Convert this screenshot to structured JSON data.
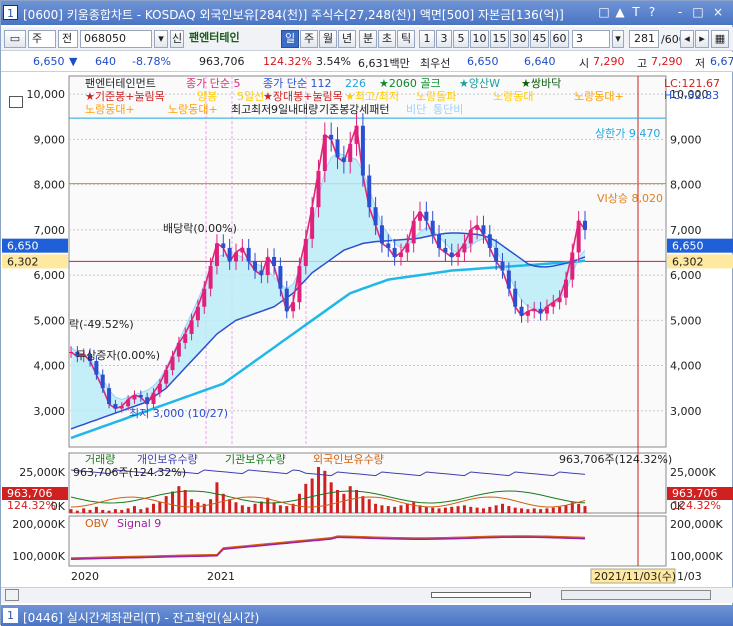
{
  "window": {
    "number": "1",
    "title": "[0600] 키움종합차트 - KOSDAQ 외국인보유[284(천)] 주식수[27,248(천)] 액면[500] 자본금[136(억)]",
    "title_buttons": [
      "□",
      "▲",
      "T",
      "?",
      "-",
      "□",
      "×"
    ]
  },
  "toolbar": {
    "market": "주",
    "code_label": "전",
    "code": "068050",
    "new_badge": "신",
    "stock_name": "팬엔터테인",
    "periods": [
      "일",
      "주",
      "월",
      "년",
      "분",
      "초",
      "틱"
    ],
    "period_selected": "일",
    "intervals": [
      "1",
      "3",
      "5",
      "10",
      "15",
      "30",
      "45",
      "60"
    ],
    "interval_value": "3",
    "count": "281",
    "count_total": "/600"
  },
  "quote": {
    "price": "6,650",
    "arrow": "▼",
    "change": "640",
    "change_pct": "-8.78%",
    "volume": "963,706",
    "volume_pct": "124.32%",
    "turnover_pct": "3.54%",
    "amount": "6,631백만",
    "best_label": "최우선",
    "ask": "6,650",
    "bid": "6,640",
    "open_label": "시",
    "open": "7,290",
    "high_label": "고",
    "high": "7,290",
    "low_label": "저",
    "low": "6,67"
  },
  "chart_data": {
    "type": "line",
    "price_panel": {
      "ylim": [
        2200,
        10400
      ],
      "y_ticks": [
        "10,000",
        "9,000",
        "8,000",
        "7,000",
        "6,000",
        "5,000",
        "4,000",
        "3,000"
      ],
      "last_close": "6,650",
      "crosshair_value": "6,302",
      "upper_limit_label": "상한가 9,470",
      "vi_label": "VI상승 8,020",
      "lc_label": "LC:121.67",
      "hc_label": "HC:-32.83",
      "legend": [
        "팬엔터테인먼트",
        "종가 단순 5",
        "종가 단순 112",
        "226",
        "★2060 골크",
        "★양산W",
        "★쌍바닥",
        "★기준봉+눌림목",
        "양봉",
        "5일선",
        "★장대봉+눌림목",
        "★최고/최저",
        "노랑돌파",
        "노랑동대",
        "노랑동대+",
        "노랑동대+",
        "노랑동대+",
        "최고",
        "최저",
        "9일내",
        "대량",
        "기준봉",
        "강세패턴",
        "비단",
        "통단비"
      ],
      "annotations": [
        "배당락(0.00%)",
        "락(-49.52%)",
        "무상증자(0.00%)",
        "최저 3,000 (10/27)"
      ],
      "close": [
        4300,
        4200,
        4250,
        4100,
        3800,
        3500,
        3150,
        3050,
        3100,
        3250,
        3350,
        3300,
        3150,
        3400,
        3600,
        3900,
        4200,
        4500,
        4700,
        5000,
        5300,
        5700,
        6200,
        6700,
        6600,
        6300,
        6500,
        6600,
        6300,
        6100,
        6000,
        6400,
        6200,
        5700,
        5200,
        5400,
        6200,
        6800,
        7500,
        8300,
        9100,
        9000,
        8600,
        8500,
        8900,
        9300,
        8200,
        7500,
        7100,
        6700,
        6600,
        6400,
        6500,
        6700,
        7200,
        7400,
        7200,
        6900,
        6600,
        6500,
        6400,
        6500,
        6700,
        7000,
        7100,
        6900,
        6600,
        6300,
        6100,
        5700,
        5300,
        5100,
        5200,
        5250,
        5150,
        5300,
        5400,
        5500,
        5900,
        6500,
        7200,
        7000
      ],
      "ma_short": [
        4400,
        4300,
        4250,
        4150,
        3950,
        3700,
        3450,
        3300,
        3250,
        3300,
        3350,
        3400,
        3450,
        3550,
        3700,
        3950,
        4250,
        4550,
        4850,
        5150,
        5450,
        5800,
        6150,
        6400,
        6450,
        6450,
        6450,
        6400,
        6300,
        6250,
        6200,
        6100,
        5950,
        5800,
        5700,
        5800,
        6100,
        6550,
        7100,
        7700,
        8300,
        8600,
        8700,
        8650,
        8600,
        8550,
        8300,
        7900,
        7500,
        7100,
        6900,
        6700,
        6600,
        6650,
        6800,
        6950,
        7050,
        7000,
        6850,
        6700,
        6550,
        6500,
        6550,
        6650,
        6750,
        6800,
        6750,
        6550,
        6300,
        6000,
        5700,
        5450,
        5300,
        5250,
        5250,
        5300,
        5350,
        5450,
        5650,
        6000,
        6400,
        6550
      ],
      "ma_mid": [
        2600,
        2650,
        2700,
        2750,
        2800,
        2850,
        2900,
        2950,
        3000,
        3050,
        3100,
        3150,
        3200,
        3300,
        3400,
        3500,
        3650,
        3800,
        3950,
        4100,
        4250,
        4400,
        4550,
        4700,
        4800,
        4900,
        5000,
        5050,
        5100,
        5150,
        5200,
        5250,
        5300,
        5400,
        5500,
        5600,
        5750,
        5900,
        6050,
        6150,
        6250,
        6350,
        6450,
        6550,
        6600,
        6650,
        6700,
        6720,
        6740,
        6750,
        6760,
        6770,
        6780,
        6790,
        6800,
        6820,
        6850,
        6880,
        6900,
        6920,
        6930,
        6930,
        6920,
        6910,
        6900,
        6870,
        6820,
        6750,
        6650,
        6550,
        6450,
        6350,
        6250,
        6200,
        6180,
        6180,
        6200,
        6230,
        6260,
        6300,
        6350,
        6400
      ],
      "ma_long": [
        2400,
        2450,
        2500,
        2550,
        2600,
        2650,
        2700,
        2750,
        2800,
        2850,
        2900,
        2950,
        3000,
        3050,
        3100,
        3150,
        3200,
        3250,
        3300,
        3350,
        3400,
        3450,
        3500,
        3550,
        3600,
        3700,
        3800,
        3900,
        4000,
        4100,
        4200,
        4300,
        4400,
        4500,
        4600,
        4700,
        4800,
        4900,
        5000,
        5100,
        5200,
        5300,
        5400,
        5500,
        5600,
        5650,
        5700,
        5750,
        5800,
        5850,
        5900,
        5920,
        5940,
        5960,
        5980,
        6000,
        6020,
        6040,
        6060,
        6080,
        6100,
        6110,
        6120,
        6130,
        6140,
        6150,
        6160,
        6170,
        6180,
        6190,
        6200,
        6210,
        6220,
        6230,
        6240,
        6250,
        6260,
        6270,
        6280,
        6290,
        6300,
        6320
      ]
    },
    "volume_panel": {
      "legend": [
        "거래량",
        "개인보유수량",
        "기관보유수량",
        "외국인보유수량"
      ],
      "title_values": "963,706주(124.32%)",
      "sub_values": "963,706주(124.32%)",
      "y_ticks": [
        "25,000K",
        "0K"
      ],
      "last_value": "963,706",
      "last_pct": "124.32%",
      "volume": [
        5,
        3,
        6,
        4,
        8,
        4,
        3,
        5,
        4,
        6,
        9,
        5,
        7,
        12,
        15,
        22,
        28,
        35,
        30,
        18,
        14,
        12,
        18,
        40,
        25,
        18,
        14,
        10,
        8,
        12,
        15,
        20,
        14,
        10,
        9,
        12,
        25,
        38,
        45,
        60,
        55,
        40,
        30,
        25,
        35,
        30,
        22,
        18,
        12,
        10,
        9,
        8,
        10,
        12,
        14,
        10,
        8,
        7,
        6,
        7,
        8,
        9,
        10,
        8,
        7,
        6,
        8,
        10,
        12,
        9,
        7,
        6,
        5,
        6,
        5,
        6,
        7,
        8,
        10,
        14,
        12,
        9
      ]
    },
    "obv_panel": {
      "legend": [
        "OBV",
        "Signal 9"
      ],
      "y_ticks": [
        "200,000K",
        "100,000K"
      ]
    },
    "x_axis": {
      "labels": [
        "2020",
        "2021"
      ],
      "date_label": "2021/11/03(수)",
      "date_suffix": "1/03"
    }
  },
  "bottom_window": {
    "number": "1",
    "title": "[0446] 실시간계좌관리(T) - 잔고확인(실시간)"
  }
}
